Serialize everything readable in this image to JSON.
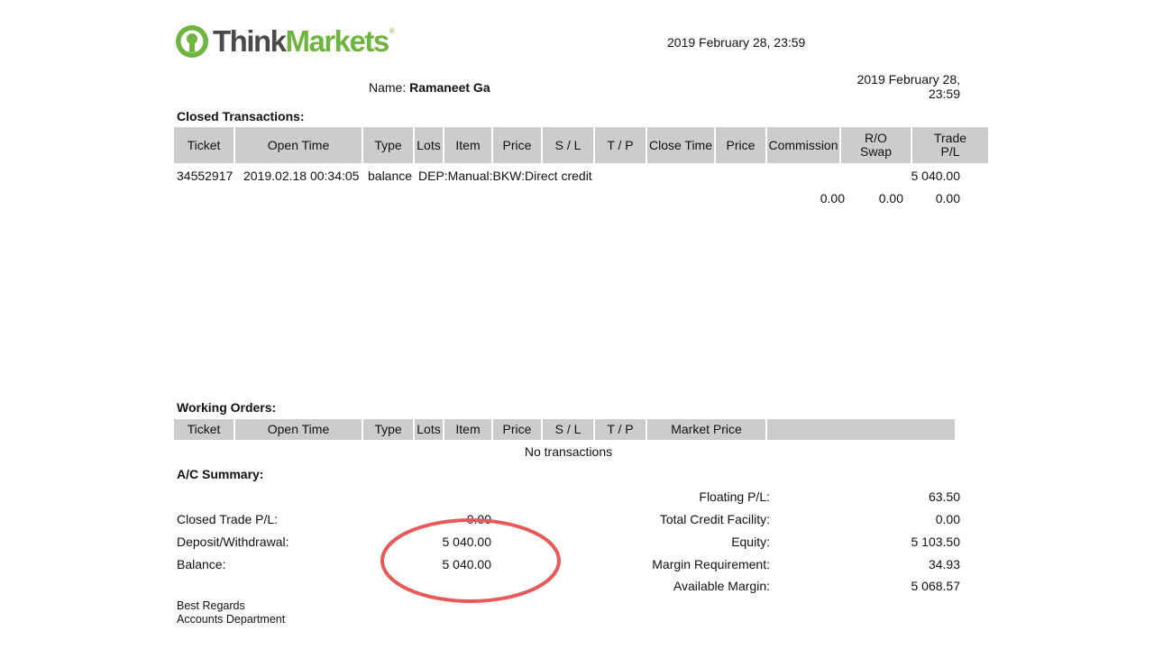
{
  "brand": {
    "think": "Think",
    "markets": "Markets",
    "reg": "®"
  },
  "report_date": "2019 February 28, 23:59",
  "name_label": "Name:",
  "name_value": "Ramaneet Ga",
  "report_date_right_line1": "2019 February 28,",
  "report_date_right_line2": "23:59",
  "closed": {
    "title": "Closed Transactions:",
    "headers": [
      "Ticket",
      "Open Time",
      "Type",
      "Lots",
      "Item",
      "Price",
      "S / L",
      "T / P",
      "Close Time",
      "Price",
      "Commission",
      "R/O Swap",
      "Trade P/L"
    ],
    "row": {
      "ticket": "34552917",
      "open_time": "2019.02.18 00:34:05",
      "type": "balance",
      "item": "DEP:Manual:BKW:Direct credit",
      "trade_pl": "5 040.00"
    },
    "totals": {
      "commission": "0.00",
      "swap": "0.00",
      "trade_pl": "0.00"
    }
  },
  "working": {
    "title": "Working Orders:",
    "headers": [
      "Ticket",
      "Open Time",
      "Type",
      "Lots",
      "Item",
      "Price",
      "S / L",
      "T / P",
      "Market Price",
      ""
    ],
    "empty_text": "No transactions"
  },
  "summary": {
    "title": "A/C Summary:",
    "left": [
      {
        "label": "Closed Trade P/L:",
        "value": "0.00"
      },
      {
        "label": "Deposit/Withdrawal:",
        "value": "5 040.00"
      },
      {
        "label": "Balance:",
        "value": "5 040.00"
      }
    ],
    "right": [
      {
        "label": "Floating P/L:",
        "value": "63.50"
      },
      {
        "label": "Total Credit Facility:",
        "value": "0.00"
      },
      {
        "label": "Equity:",
        "value": "5 103.50"
      },
      {
        "label": "Margin Requirement:",
        "value": "34.93"
      },
      {
        "label": "Available Margin:",
        "value": "5 068.57"
      }
    ]
  },
  "footer": {
    "line1": "Best Regards",
    "line2": "Accounts Department"
  },
  "colors": {
    "header_bg": "#cccccc",
    "brand_green": "#6fb43f",
    "brand_gray": "#4a4a4a",
    "annotation": "#e85a5a"
  }
}
